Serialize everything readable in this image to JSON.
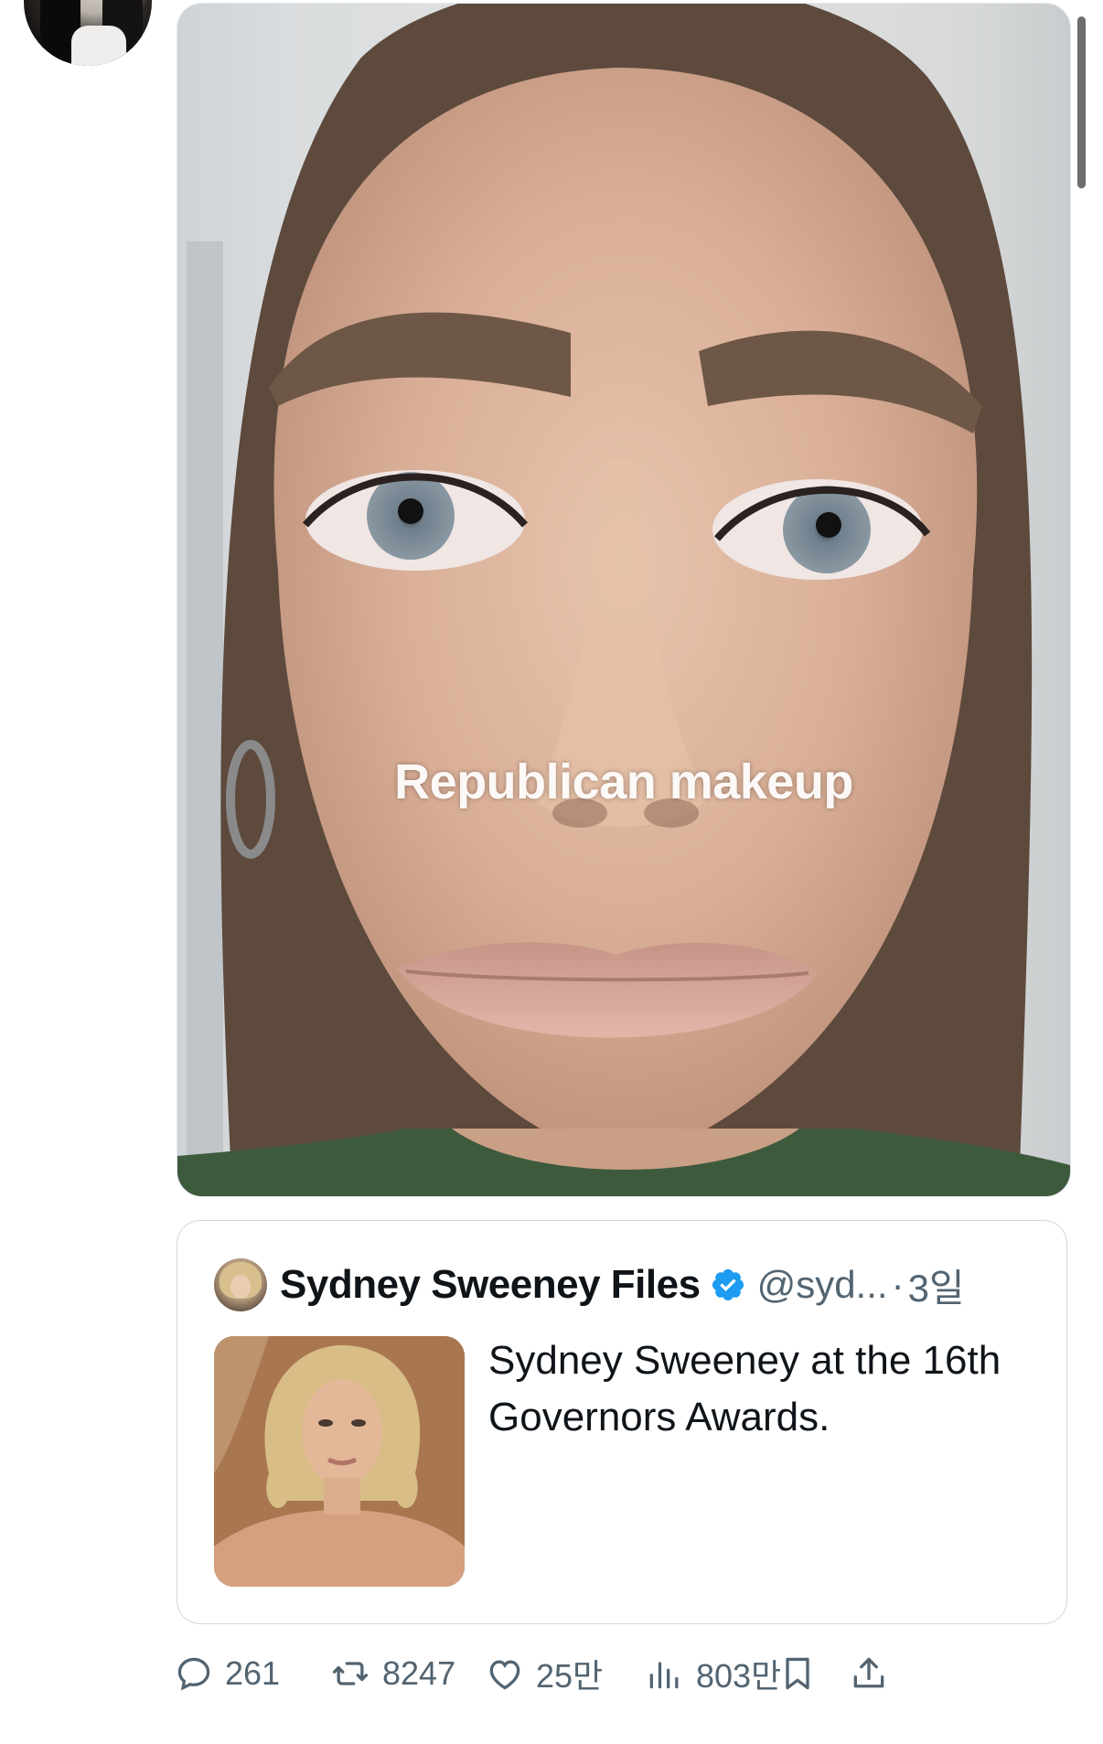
{
  "post": {
    "media": {
      "overlay_text": "Republican makeup"
    }
  },
  "quote": {
    "name": "Sydney Sweeney Files",
    "handle": "@syd...",
    "separator": "·",
    "time": "3일",
    "text": "Sydney Sweeney at the 16th Governors Awards."
  },
  "actions": {
    "replies": "261",
    "reposts": "8247",
    "likes": "25만",
    "views": "803만"
  },
  "icons": {
    "reply": "reply-icon",
    "repost": "repost-icon",
    "like": "heart-icon",
    "views": "views-icon",
    "bookmark": "bookmark-icon",
    "share": "share-icon",
    "verified": "verified-badge-icon"
  },
  "colors": {
    "text_primary": "#0f1419",
    "text_secondary": "#536471",
    "verified_blue": "#1d9bf0",
    "border": "#cfd9de"
  }
}
